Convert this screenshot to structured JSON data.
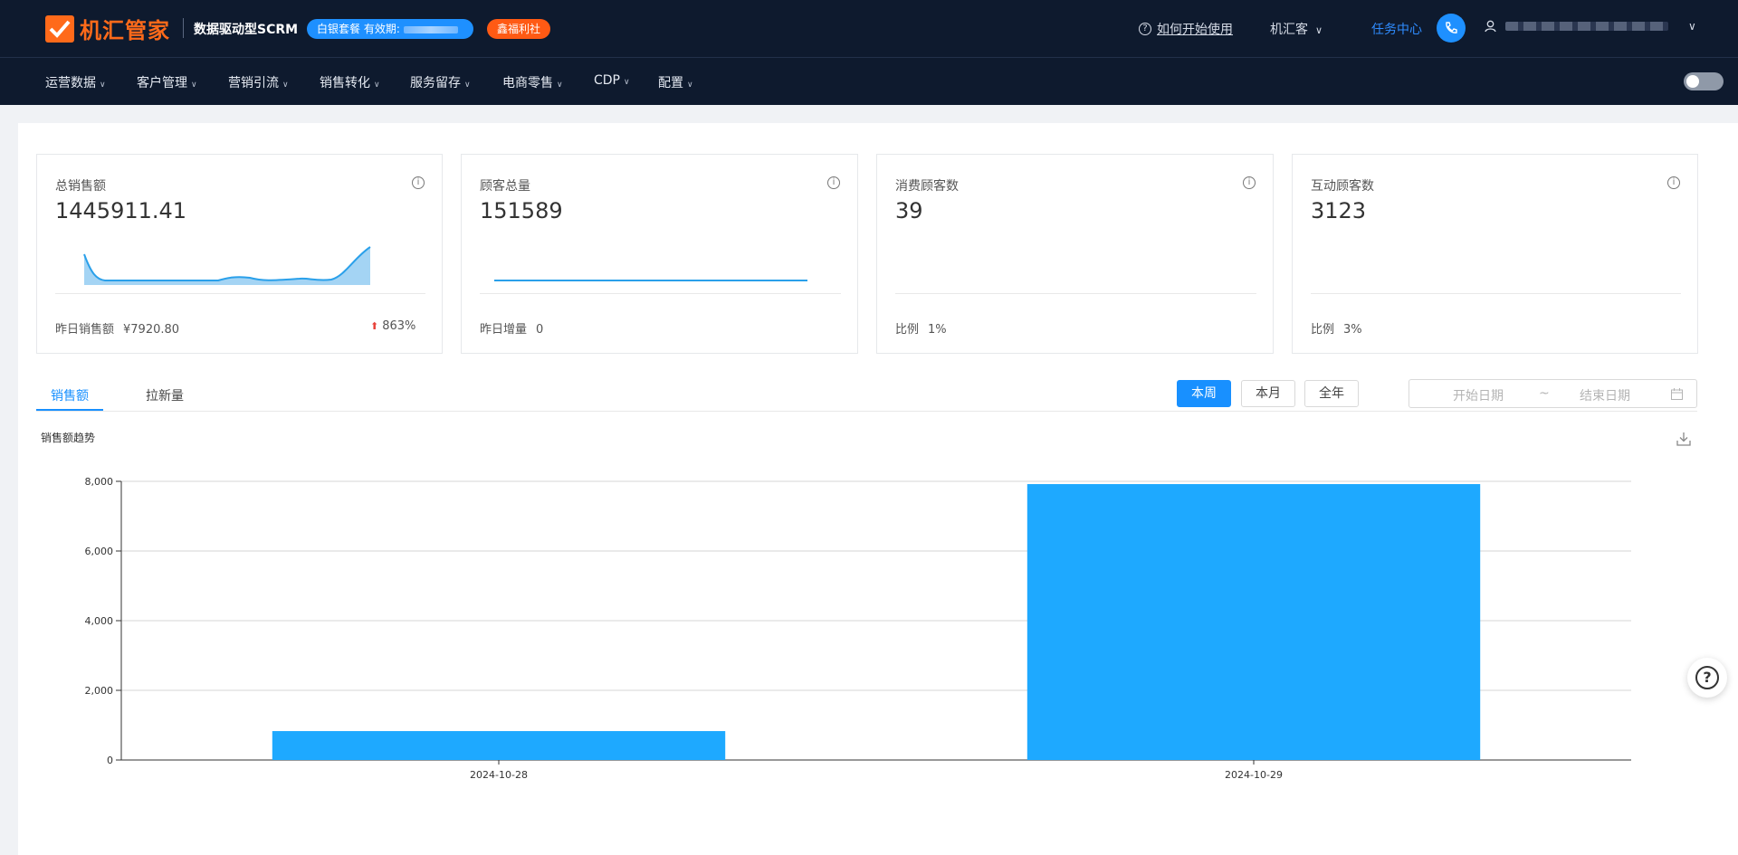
{
  "header": {
    "logo_text": "机汇管家",
    "tagline": "数据驱动型SCRM",
    "package_badge": "白银套餐 有效期:",
    "welfare_badge": "鑫福利社",
    "how_to": "如何开始使用",
    "org": "机汇客",
    "task_center": "任务中心"
  },
  "nav": {
    "items": [
      {
        "label": "运营数据"
      },
      {
        "label": "客户管理"
      },
      {
        "label": "营销引流"
      },
      {
        "label": "销售转化"
      },
      {
        "label": "服务留存"
      },
      {
        "label": "电商零售"
      },
      {
        "label": "CDP"
      },
      {
        "label": "配置"
      }
    ]
  },
  "cards": [
    {
      "title": "总销售额",
      "value": "1445911.41",
      "foot_label": "昨日销售额",
      "foot_value": "¥7920.80",
      "trend": "863%"
    },
    {
      "title": "顾客总量",
      "value": "151589",
      "foot_label": "昨日增量",
      "foot_value": "0"
    },
    {
      "title": "消费顾客数",
      "value": "39",
      "foot_label": "比例",
      "foot_value": "1%"
    },
    {
      "title": "互动顾客数",
      "value": "3123",
      "foot_label": "比例",
      "foot_value": "3%"
    }
  ],
  "tabs": [
    {
      "label": "销售额",
      "active": true
    },
    {
      "label": "拉新量",
      "active": false
    }
  ],
  "range_buttons": [
    {
      "label": "本周",
      "active": true
    },
    {
      "label": "本月",
      "active": false
    },
    {
      "label": "全年",
      "active": false
    }
  ],
  "date_range": {
    "start_placeholder": "开始日期",
    "separator": "~",
    "end_placeholder": "结束日期"
  },
  "chart_title": "销售额趋势",
  "colors": {
    "header_bg": "#0e1a2e",
    "brand_orange": "#ff6a1a",
    "accent_blue": "#1890ff",
    "bar_blue": "#1ea9ff"
  },
  "chart_data": {
    "type": "bar",
    "categories": [
      "2024-10-28",
      "2024-10-29"
    ],
    "values": [
      830,
      7920.8
    ],
    "title": "销售额趋势",
    "xlabel": "",
    "ylabel": "",
    "ylim": [
      0,
      8000
    ],
    "yticks": [
      "0",
      "2,000",
      "4,000",
      "6,000",
      "8,000"
    ],
    "grid": true
  }
}
